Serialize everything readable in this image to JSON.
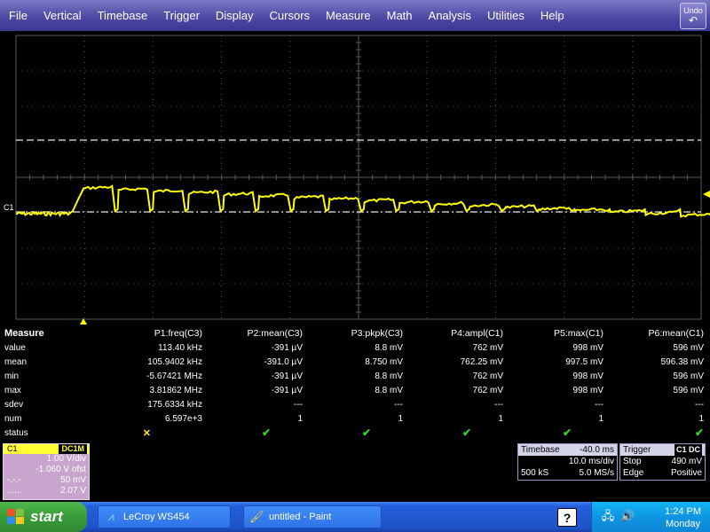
{
  "menu": {
    "items": [
      "File",
      "Vertical",
      "Timebase",
      "Trigger",
      "Display",
      "Cursors",
      "Measure",
      "Math",
      "Analysis",
      "Utilities",
      "Help"
    ],
    "undo_label": "Undo"
  },
  "scope": {
    "channel_marker": "C1",
    "trace_color": "#ffff00",
    "grid_color": "#5a5a5a"
  },
  "measure": {
    "title": "Measure",
    "headers": [
      "P1:freq(C3)",
      "P2:mean(C3)",
      "P3:pkpk(C3)",
      "P4:ampl(C1)",
      "P5:max(C1)",
      "P6:mean(C1)"
    ],
    "rows": [
      {
        "label": "value",
        "cells": [
          "113.40 kHz",
          "-391 µV",
          "8.8 mV",
          "762 mV",
          "998 mV",
          "596 mV"
        ]
      },
      {
        "label": "mean",
        "cells": [
          "105.9402 kHz",
          "-391.0 µV",
          "8.750 mV",
          "762.25 mV",
          "997.5 mV",
          "596.38 mV"
        ]
      },
      {
        "label": "min",
        "cells": [
          "-5.67421 MHz",
          "-391 µV",
          "8.8 mV",
          "762 mV",
          "998 mV",
          "596 mV"
        ]
      },
      {
        "label": "max",
        "cells": [
          "3.81862 MHz",
          "-391 µV",
          "8.8 mV",
          "762 mV",
          "998 mV",
          "596 mV"
        ]
      },
      {
        "label": "sdev",
        "cells": [
          "175.6334 kHz",
          "---",
          "---",
          "---",
          "---",
          "---"
        ]
      },
      {
        "label": "num",
        "cells": [
          "6.597e+3",
          "1",
          "1",
          "1",
          "1",
          "1"
        ]
      },
      {
        "label": "status",
        "cells": [
          "cross",
          "check",
          "check",
          "check",
          "check",
          "check"
        ]
      }
    ]
  },
  "c1": {
    "name": "C1",
    "coupling": "DC1M",
    "scale": "1.00 V/div",
    "offset": "-1.060 V ofst",
    "row3_left": "-.-.-",
    "row3_right": "50 mV",
    "row4_left": "......",
    "row4_right": "2.07 V"
  },
  "timebase": {
    "title": "Timebase",
    "delay": "-40.0 ms",
    "per_div": "10.0 ms/div",
    "samples": "500 kS",
    "rate": "5.0 MS/s"
  },
  "trigger": {
    "title": "Trigger",
    "source_tag": "C1 DC",
    "mode": "Stop",
    "level": "490 mV",
    "type": "Edge",
    "slope": "Positive"
  },
  "taskbar": {
    "start_label": "start",
    "tasks": [
      "LeCroy WS454",
      "untitled - Paint"
    ],
    "help_label": "?",
    "time": "1:24 PM",
    "day": "Monday"
  }
}
